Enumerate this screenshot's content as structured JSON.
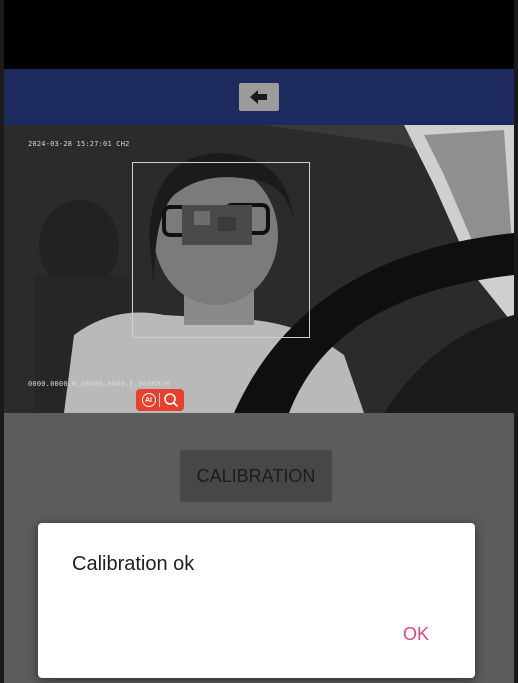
{
  "camera": {
    "timestamp_text": "2024-03-28 15:27:01 CH2",
    "gps_text": "0000.0000,N,00000.0000,E,000KM/H",
    "ai_badge_label": "AI"
  },
  "main": {
    "calibration_label": "CALIBRATION"
  },
  "dialog": {
    "message": "Calibration ok",
    "ok_label": "OK"
  },
  "colors": {
    "app_bar": "#1c2a5e",
    "badge": "#e8402c",
    "dialog_accent": "#e0477b"
  },
  "icons": {
    "back": "arrow-left-icon",
    "ai": "ai-icon",
    "search": "search-icon"
  }
}
